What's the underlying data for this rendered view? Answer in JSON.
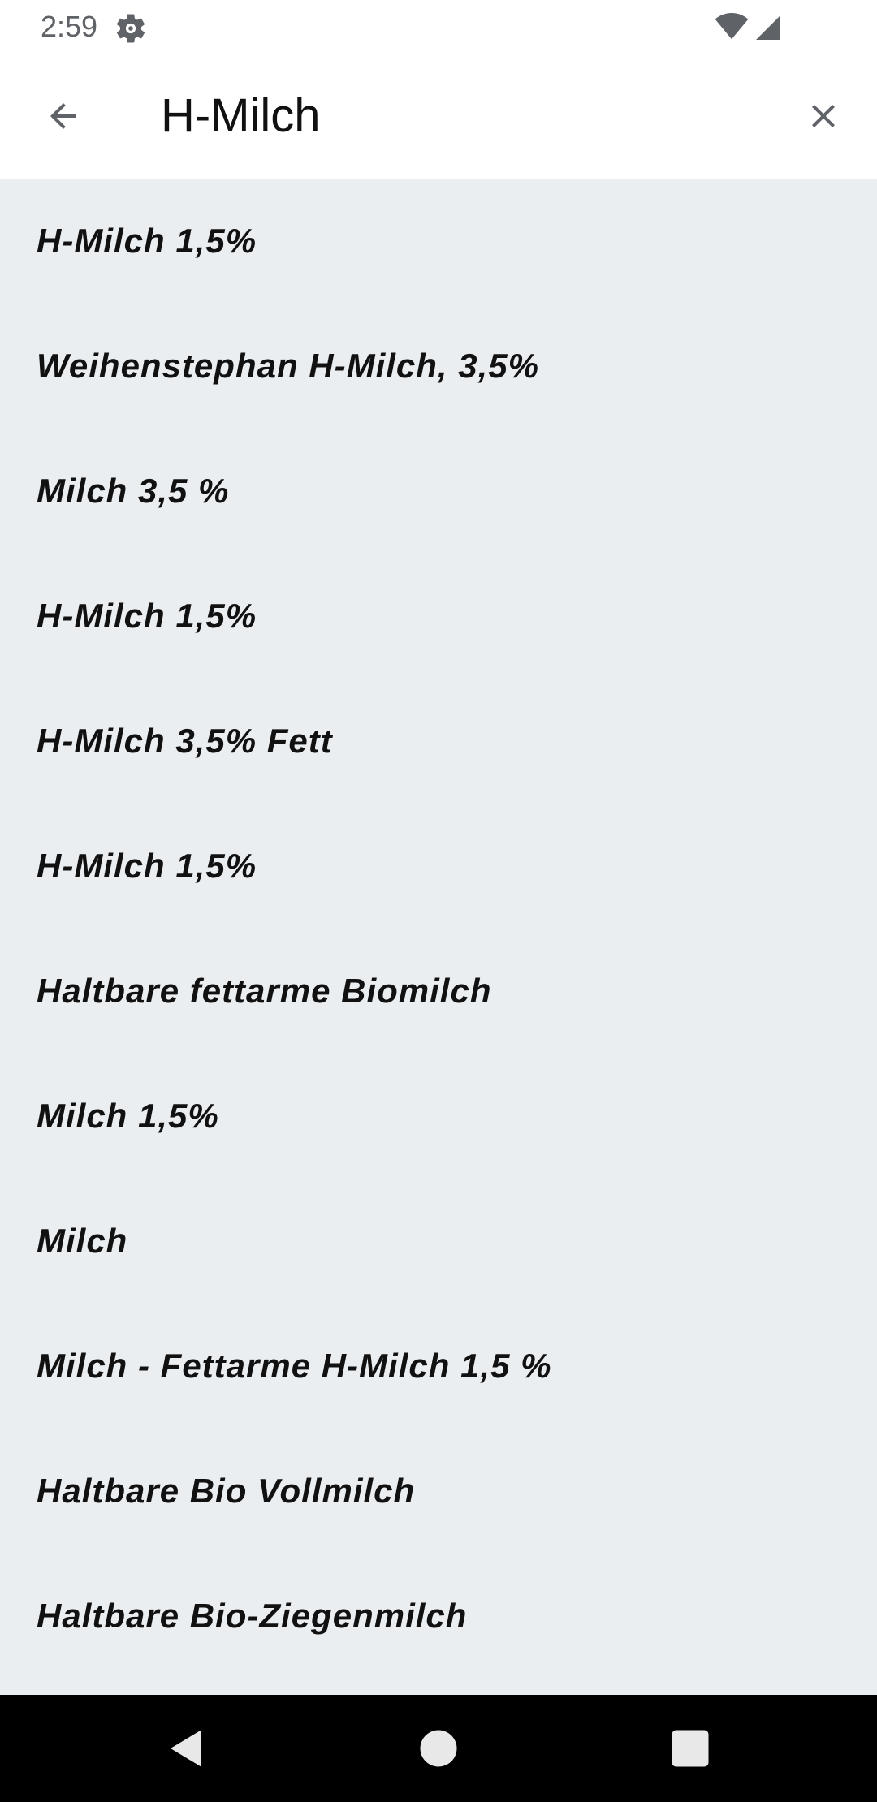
{
  "status_bar": {
    "time": "2:59"
  },
  "search": {
    "query": "H-Milch"
  },
  "results": [
    {
      "label": "H-Milch 1,5%"
    },
    {
      "label": "Weihenstephan H-Milch, 3,5%"
    },
    {
      "label": "Milch 3,5 %"
    },
    {
      "label": "H-Milch 1,5%"
    },
    {
      "label": "H-Milch 3,5% Fett"
    },
    {
      "label": "H-Milch 1,5%"
    },
    {
      "label": "Haltbare fettarme Biomilch"
    },
    {
      "label": "Milch 1,5%"
    },
    {
      "label": "Milch"
    },
    {
      "label": "Milch - Fettarme H-Milch 1,5 %"
    },
    {
      "label": "Haltbare Bio Vollmilch"
    },
    {
      "label": "Haltbare Bio-Ziegenmilch"
    }
  ],
  "icons": {
    "settings": "gear-icon",
    "wifi": "wifi-icon",
    "signal": "signal-icon",
    "back": "arrow-left-icon",
    "clear": "close-icon",
    "nav_back": "triangle-back-icon",
    "nav_home": "circle-home-icon",
    "nav_recents": "square-recents-icon"
  },
  "colors": {
    "background": "#ebeef1",
    "toolbar": "#ffffff",
    "text": "#111111",
    "icon_gray": "#5f6368",
    "nav_bar": "#000000"
  }
}
